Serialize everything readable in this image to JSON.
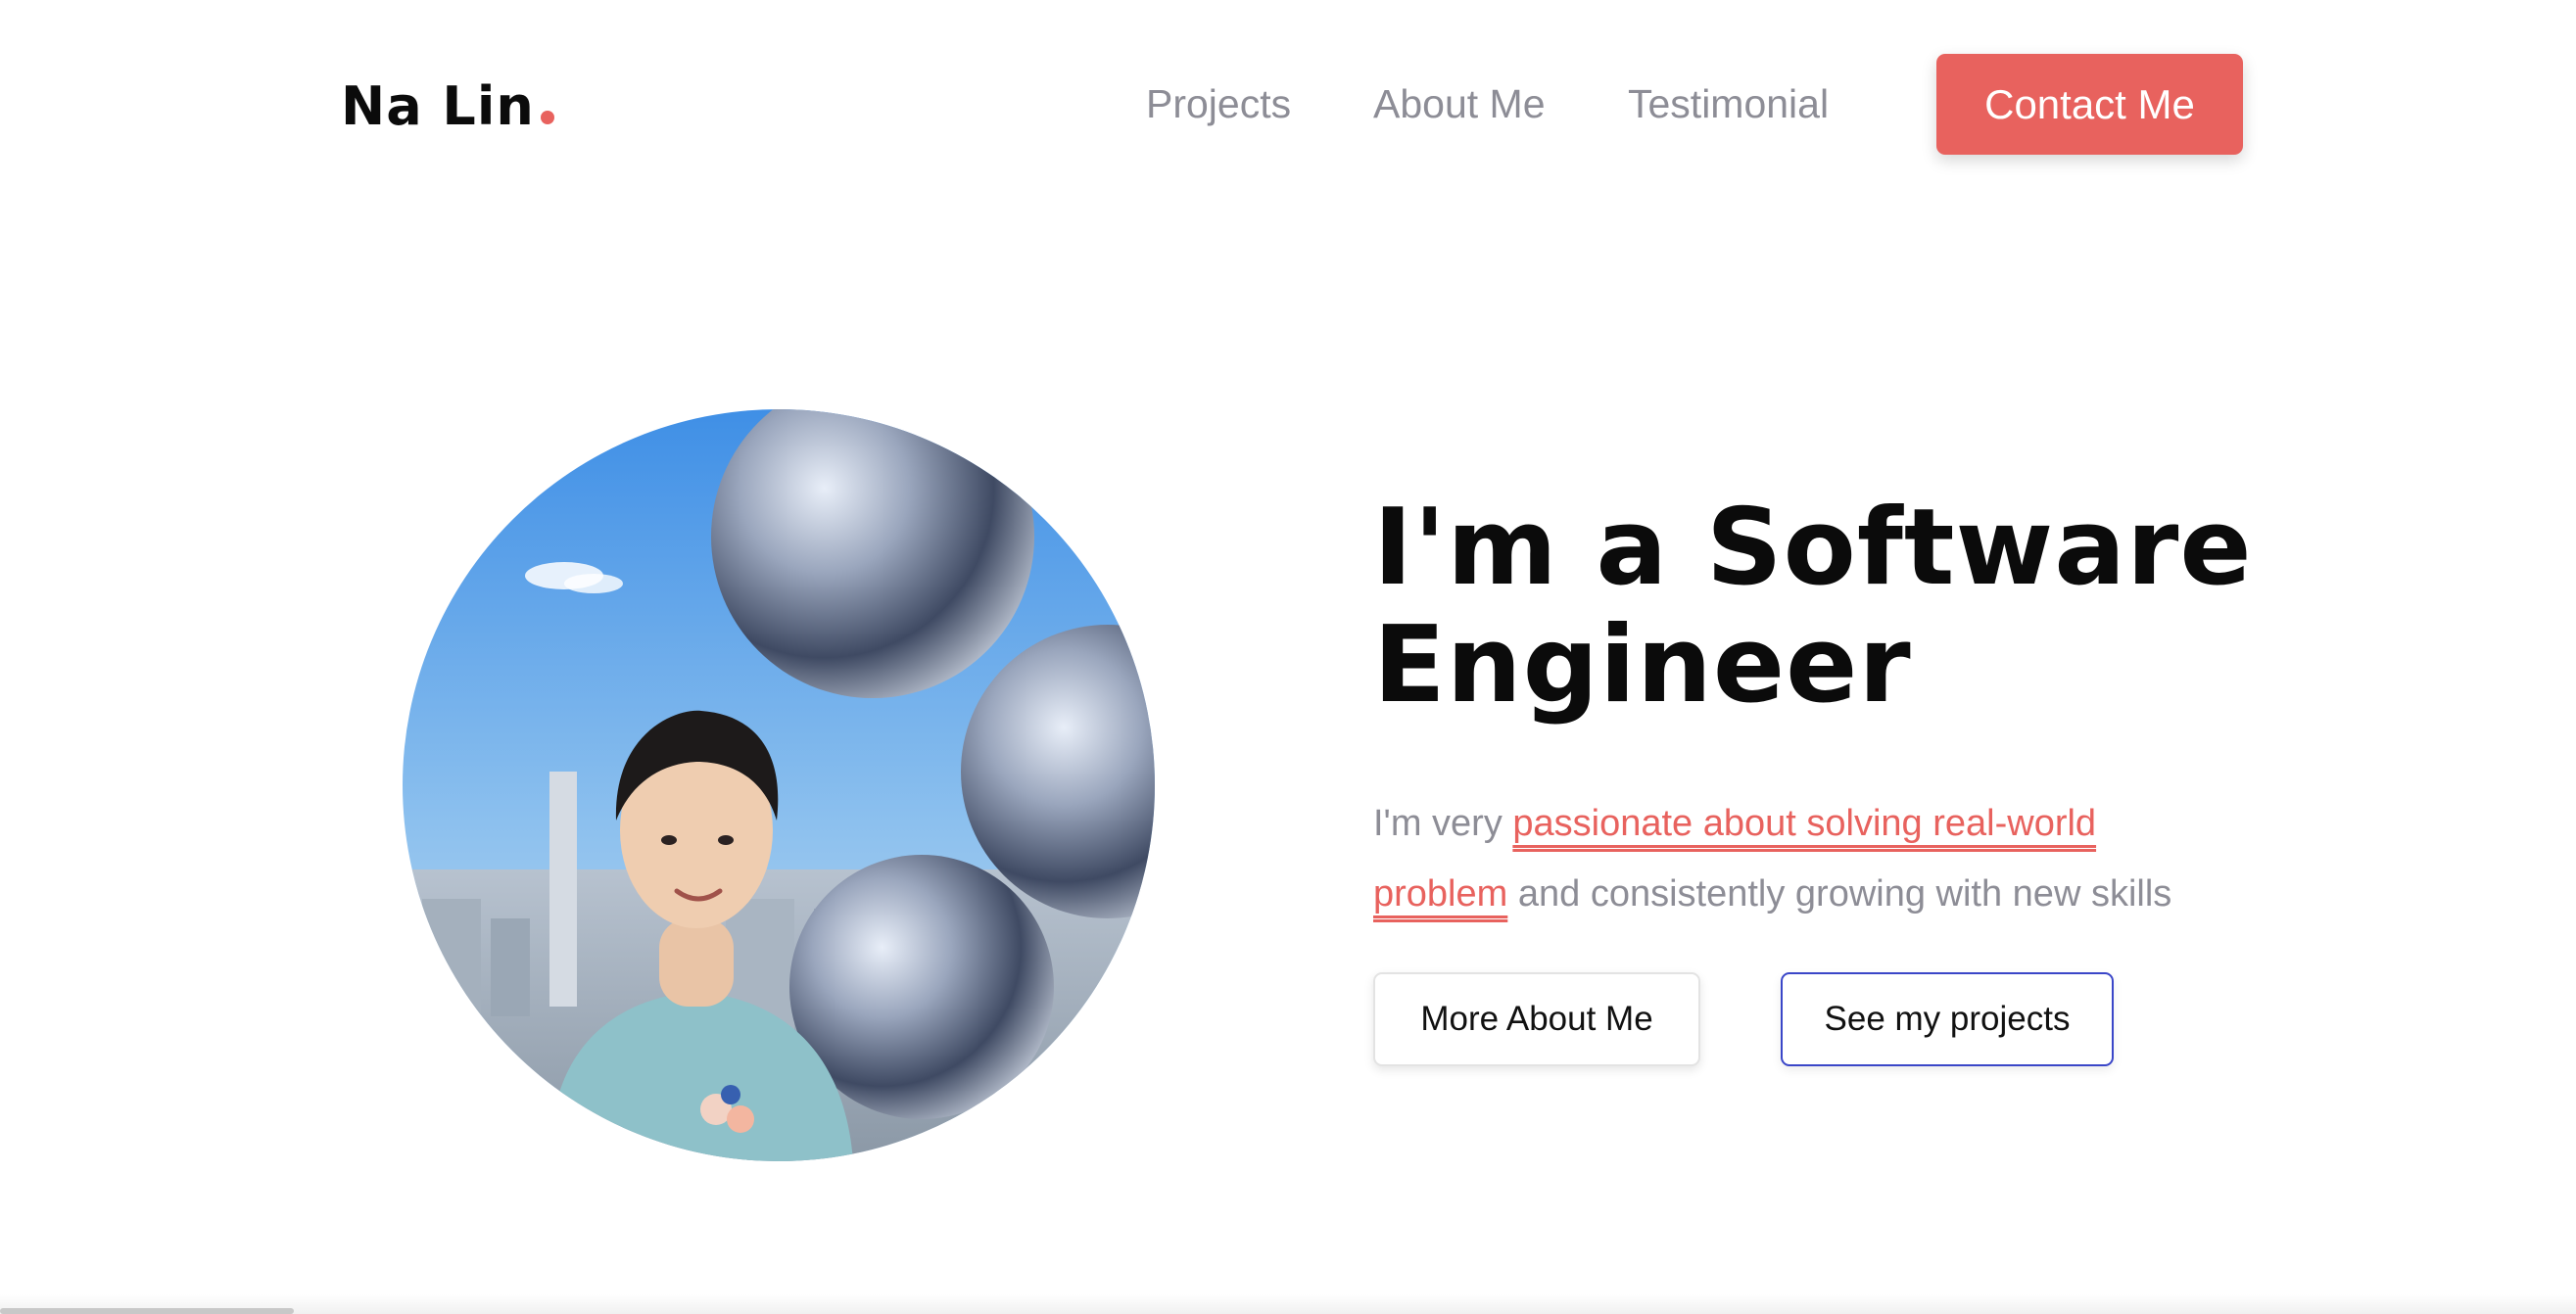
{
  "brand": {
    "name": "Na Lin",
    "accent_color": "#e8625e"
  },
  "nav": {
    "links": [
      {
        "label": "Projects"
      },
      {
        "label": "About Me"
      },
      {
        "label": "Testimonial"
      }
    ],
    "cta_label": "Contact Me"
  },
  "hero": {
    "photo_icon": "profile-photo",
    "headline": "I'm a Software Engineer",
    "subtext_prefix": "I'm very ",
    "subtext_highlight": "passionate about solving real-world problem",
    "subtext_suffix": " and consistently growing with new skills",
    "buttons": {
      "about_label": "More About Me",
      "projects_label": "See my projects"
    }
  },
  "colors": {
    "accent": "#e8625e",
    "nav_text": "#8d8d96",
    "outline_blue": "#3a46c8",
    "headline": "#0b0b0b"
  }
}
